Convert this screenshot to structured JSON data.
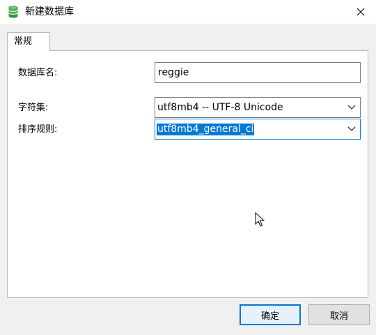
{
  "window": {
    "title": "新建数据库",
    "icon": "database-icon",
    "close_icon": "close-icon"
  },
  "tabs": [
    {
      "label": "常规",
      "active": true
    }
  ],
  "form": {
    "db_name_label": "数据库名:",
    "db_name_value": "reggie",
    "charset_label": "字符集:",
    "charset_value": "utf8mb4 -- UTF-8 Unicode",
    "collation_label": "排序规则:",
    "collation_value": "utf8mb4_general_ci"
  },
  "buttons": {
    "ok": "确定",
    "cancel": "取消"
  },
  "colors": {
    "accent": "#0078d7",
    "database_icon": "#4caf50"
  }
}
